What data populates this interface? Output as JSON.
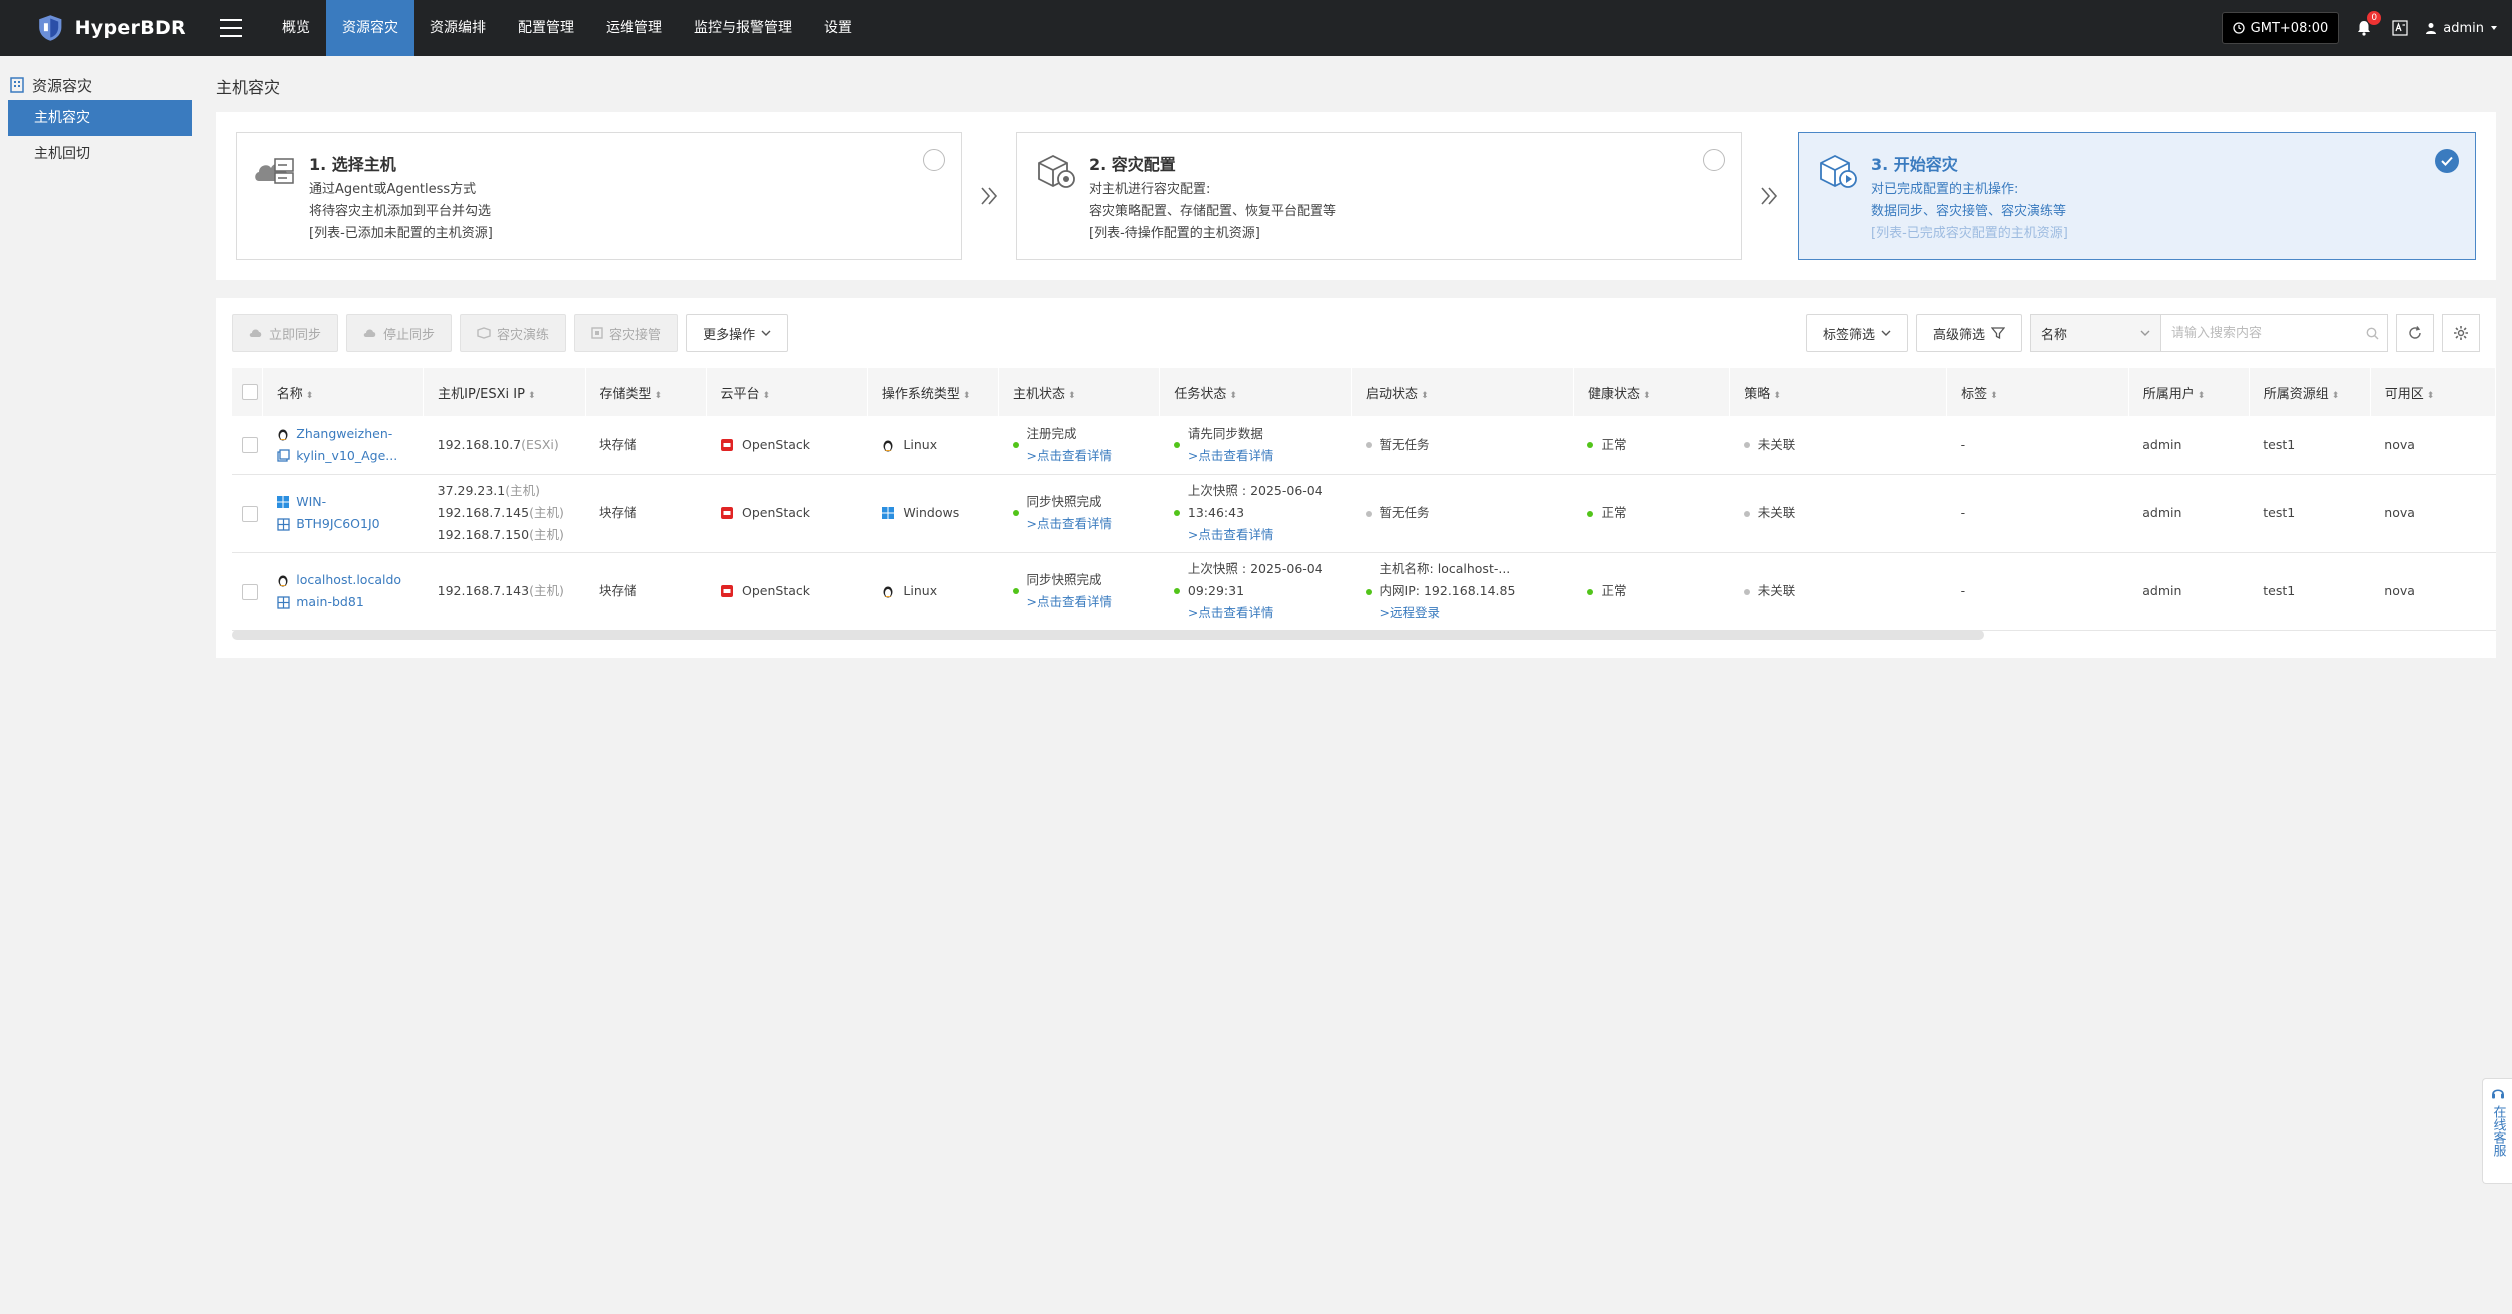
{
  "app": {
    "name": "HyperBDR"
  },
  "topnav": {
    "items": [
      {
        "label": "概览"
      },
      {
        "label": "资源容灾"
      },
      {
        "label": "资源编排"
      },
      {
        "label": "配置管理"
      },
      {
        "label": "运维管理"
      },
      {
        "label": "监控与报警管理"
      },
      {
        "label": "设置"
      }
    ],
    "timezone": "GMT+08:00",
    "notification_count": "0",
    "user": "admin"
  },
  "sidebar": {
    "title": "资源容灾",
    "items": [
      {
        "label": "主机容灾"
      },
      {
        "label": "主机回切"
      }
    ]
  },
  "page": {
    "title": "主机容灾"
  },
  "steps": [
    {
      "title": "1. 选择主机",
      "lines": [
        "通过Agent或Agentless方式",
        "将待容灾主机添加到平台并勾选",
        "[列表-已添加未配置的主机资源]"
      ]
    },
    {
      "title": "2. 容灾配置",
      "lines": [
        "对主机进行容灾配置:",
        "容灾策略配置、存储配置、恢复平台配置等",
        "[列表-待操作配置的主机资源]"
      ]
    },
    {
      "title": "3. 开始容灾",
      "lines": [
        "对已完成配置的主机操作:",
        "数据同步、容灾接管、容灾演练等",
        "[列表-已完成容灾配置的主机资源]"
      ]
    }
  ],
  "toolbar": {
    "sync_now": "立即同步",
    "stop_sync": "停止同步",
    "dr_drill": "容灾演练",
    "dr_takeover": "容灾接管",
    "more_actions": "更多操作",
    "tag_filter": "标签筛选",
    "advanced_filter": "高级筛选",
    "search_field": "名称",
    "search_placeholder": "请输入搜索内容"
  },
  "table": {
    "columns": [
      "名称",
      "主机IP/ESXi IP",
      "存储类型",
      "云平台",
      "操作系统类型",
      "主机状态",
      "任务状态",
      "启动状态",
      "健康状态",
      "策略",
      "标签",
      "所属用户",
      "所属资源组",
      "可用区"
    ],
    "rows": [
      {
        "name1": "Zhangweizhen-",
        "name2": "kylin_v10_Age...",
        "ips": [
          {
            "ip": "192.168.10.7",
            "tag": "(ESXi)"
          }
        ],
        "storage": "块存储",
        "cloud": "OpenStack",
        "os": "Linux",
        "host_status": "注册完成",
        "host_link": ">点击查看详情",
        "task_status": [
          "请先同步数据"
        ],
        "task_link": ">点击查看详情",
        "boot_status": [
          "暂无任务"
        ],
        "health": "正常",
        "policy": "未关联",
        "tag": "-",
        "user": "admin",
        "group": "test1",
        "zone": "nova"
      },
      {
        "name1": "WIN-",
        "name2": "BTH9JC6O1J0",
        "ips": [
          {
            "ip": "37.29.23.1",
            "tag": "(主机)"
          },
          {
            "ip": "192.168.7.145",
            "tag": "(主机)"
          },
          {
            "ip": "192.168.7.150",
            "tag": "(主机)"
          }
        ],
        "storage": "块存储",
        "cloud": "OpenStack",
        "os": "Windows",
        "host_status": "同步快照完成",
        "host_link": ">点击查看详情",
        "task_status": [
          "上次快照 : 2025-06-04",
          "13:46:43"
        ],
        "task_link": ">点击查看详情",
        "boot_status": [
          "暂无任务"
        ],
        "health": "正常",
        "policy": "未关联",
        "tag": "-",
        "user": "admin",
        "group": "test1",
        "zone": "nova"
      },
      {
        "name1": "localhost.localdo",
        "name2": "main-bd81",
        "ips": [
          {
            "ip": "192.168.7.143",
            "tag": "(主机)"
          }
        ],
        "storage": "块存储",
        "cloud": "OpenStack",
        "os": "Linux",
        "host_status": "同步快照完成",
        "host_link": ">点击查看详情",
        "task_status": [
          "上次快照 : 2025-06-04",
          "09:29:31"
        ],
        "task_link": ">点击查看详情",
        "boot_status": [
          "主机名称: localhost-...",
          "内网IP: 192.168.14.85"
        ],
        "boot_link": ">远程登录",
        "health": "正常",
        "policy": "未关联",
        "tag": "-",
        "user": "admin",
        "group": "test1",
        "zone": "nova"
      }
    ]
  },
  "support_widget": {
    "label": "在线客服"
  }
}
